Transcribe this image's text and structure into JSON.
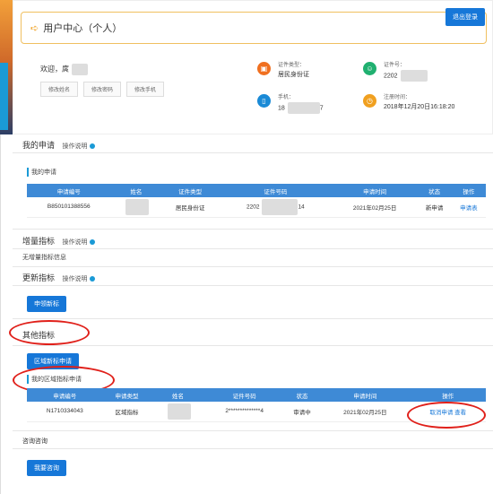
{
  "header": {
    "title": "用户中心（个人）",
    "logout_label": "退出登录",
    "welcome_text": "欢迎，庹",
    "buttons": [
      "修改姓名",
      "修改密码",
      "修改手机"
    ],
    "info": {
      "id_type_label": "证件类型：",
      "id_type_value": "居民身份证",
      "id_no_label": "证件号：",
      "id_no_value": "2202",
      "phone_label": "手机：",
      "phone_value": "18",
      "phone_value_tail": "7",
      "reg_label": "注册时间：",
      "reg_value": "2018年12月20日16:18:20"
    }
  },
  "my_apply": {
    "title": "我的申请",
    "help": "操作说明",
    "sublabel": "我的申请",
    "columns": [
      "申请编号",
      "姓名",
      "证件类型",
      "证件号码",
      "申请时间",
      "状态",
      "操作"
    ],
    "row": {
      "apply_no": "B850101388556",
      "name": "",
      "id_type": "居民身份证",
      "id_no_head": "2202",
      "id_no_tail": "14",
      "time": "2021年02月25日",
      "status": "新申请",
      "action": "申请表"
    }
  },
  "increment": {
    "title": "增量指标",
    "help": "操作说明",
    "nodata": "无增量指标信息"
  },
  "update": {
    "title": "更新指标",
    "help": "操作说明",
    "button": "申领新标"
  },
  "other": {
    "title": "其他指标",
    "button": "区域新标申请",
    "sublabel": "我的区域指标申请",
    "columns": [
      "申请编号",
      "申请类型",
      "姓名",
      "证件号码",
      "状态",
      "申请时间",
      "操作"
    ],
    "row": {
      "apply_no": "N1710334043",
      "type": "区域指标",
      "name": "",
      "id_no": "2**************4",
      "status": "审请中",
      "time": "2021年02月25日",
      "action_cancel": "取消申请",
      "action_view": "查看"
    }
  },
  "consult": {
    "title": "咨询咨询",
    "button": "我要咨询"
  },
  "colors": {
    "accent_blue": "#1677d8",
    "table_header": "#3e8ad6",
    "annotation_red": "#e0201a"
  }
}
